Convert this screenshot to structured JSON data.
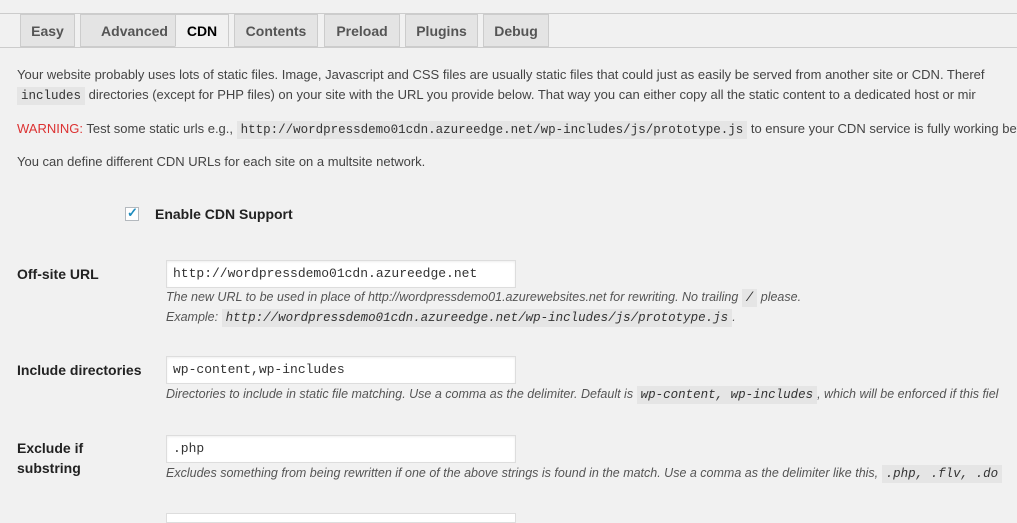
{
  "tabs": [
    "Easy",
    "Advanced",
    "CDN",
    "Contents",
    "Preload",
    "Plugins",
    "Debug"
  ],
  "active_tab": "CDN",
  "intro": {
    "line1": "Your website probably uses lots of static files. Image, Javascript and CSS files are usually static files that could just as easily be served from another site or CDN. Theref",
    "line2_code": "includes",
    "line2_text": " directories (except for PHP files) on your site with the URL you provide below. That way you can either copy all the static content to a dedicated host or mir"
  },
  "warning": {
    "label": "WARNING:",
    "text_before": " Test some static urls e.g., ",
    "example_url": "http://wordpressdemo01cdn.azureedge.net/wp-includes/js/prototype.js",
    "text_after": " to ensure your CDN service is fully working bef"
  },
  "multisite_note": "You can define different CDN URLs for each site on a multsite network.",
  "enable_cdn": {
    "label": "Enable CDN Support",
    "checked": true
  },
  "offsite_url": {
    "label": "Off-site URL",
    "value": "http://wordpressdemo01cdn.azureedge.net",
    "desc1": "The new URL to be used in place of http://wordpressdemo01.azurewebsites.net for rewriting. No trailing ",
    "desc1_code": "/",
    "desc1_end": " please.",
    "desc2": "Example: ",
    "desc2_code": "http://wordpressdemo01cdn.azureedge.net/wp-includes/js/prototype.js",
    "desc2_end": "."
  },
  "include_dirs": {
    "label": "Include directories",
    "value": "wp-content,wp-includes",
    "desc": "Directories to include in static file matching. Use a comma as the delimiter. Default is ",
    "desc_code": "wp-content, wp-includes",
    "desc_end": ", which will be enforced if this fiel"
  },
  "exclude_substring": {
    "label_line1": "Exclude if",
    "label_line2": "substring",
    "value": ".php",
    "desc": "Excludes something from being rewritten if one of the above strings is found in the match. Use a comma as the delimiter like this, ",
    "desc_code": ".php, .flv, .do"
  }
}
